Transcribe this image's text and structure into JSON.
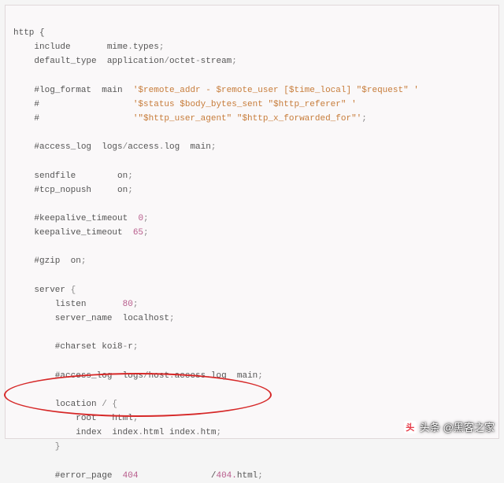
{
  "code": {
    "l0": "http {",
    "l1_a": "    include       mime",
    "l1_b": ".",
    "l1_c": "types",
    "l1_d": ";",
    "l2_a": "    default_type  application",
    "l2_b": "/",
    "l2_c": "octet",
    "l2_d": "-",
    "l2_e": "stream",
    "l2_f": ";",
    "l4_a": "    #log_format  main  ",
    "l4_b": "'$remote_addr - $remote_user [$time_local] \"$request\" '",
    "l5_a": "    #                  ",
    "l5_b": "'$status $body_bytes_sent \"$http_referer\" '",
    "l6_a": "    #                  ",
    "l6_b": "'\"$http_user_agent\" \"$http_x_forwarded_for\"'",
    "l6_c": ";",
    "l8_a": "    #access_log  logs",
    "l8_b": "/",
    "l8_c": "access",
    "l8_d": ".",
    "l8_e": "log  main",
    "l8_f": ";",
    "l10_a": "    sendfile        on",
    "l10_b": ";",
    "l11_a": "    #tcp_nopush     on",
    "l11_b": ";",
    "l13_a": "    #keepalive_timeout  ",
    "l13_b": "0",
    "l13_c": ";",
    "l14_a": "    keepalive_timeout  ",
    "l14_b": "65",
    "l14_c": ";",
    "l16_a": "    #gzip  on",
    "l16_b": ";",
    "l18_a": "    server ",
    "l18_b": "{",
    "l19_a": "        listen       ",
    "l19_b": "80",
    "l19_c": ";",
    "l20_a": "        server_name  localhost",
    "l20_b": ";",
    "l22_a": "        #charset koi8",
    "l22_b": "-",
    "l22_c": "r",
    "l22_d": ";",
    "l24_a": "        #access_log  logs",
    "l24_b": "/",
    "l24_c": "host",
    "l24_d": ".",
    "l24_e": "access",
    "l24_f": ".",
    "l24_g": "log  main",
    "l24_h": ";",
    "l26_a": "        location ",
    "l26_b": "/",
    "l26_c": " {",
    "l27_a": "            root   html",
    "l27_b": ";",
    "l28_a": "            index  index",
    "l28_b": ".",
    "l28_c": "html index",
    "l28_d": ".",
    "l28_e": "htm",
    "l28_f": ";",
    "l29": "        }",
    "l31_a": "        #error_page  ",
    "l31_b": "404",
    "l31_c": "              /",
    "l31_d": "404.",
    "l31_e": "html",
    "l31_f": ";"
  },
  "watermark": {
    "prefix": "头条",
    "user": "@黑客之家"
  }
}
